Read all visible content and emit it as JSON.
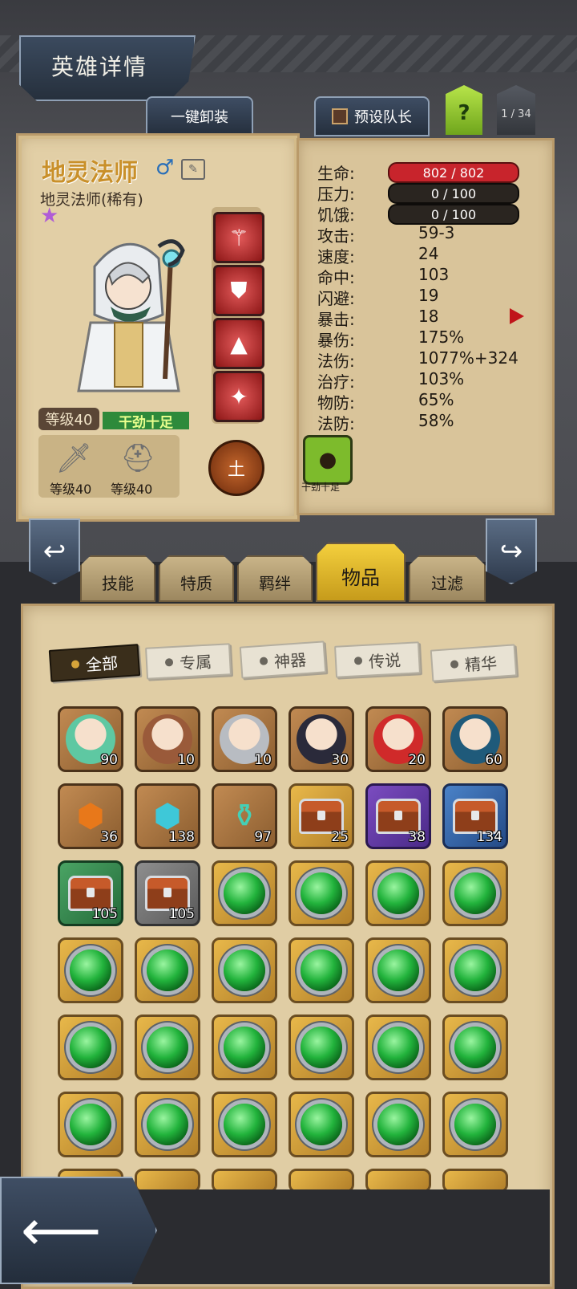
{
  "header": {
    "title": "英雄详情",
    "unequip_label": "一键卸装",
    "preset_captain_label": "预设队长",
    "help_label": "?",
    "pager": "1 / 34"
  },
  "hero": {
    "name": "地灵法师",
    "subtitle": "地灵法师(稀有)",
    "level_label": "等级40",
    "mood": "干劲十足",
    "weapon_level": "等级40",
    "armor_level": "等级40",
    "element": "土",
    "equipment_icons": [
      "staff-icon",
      "chest-armor-icon",
      "wizard-hat-icon",
      "amulet-icon"
    ]
  },
  "stats": {
    "hp": {
      "label": "生命:",
      "value": "802 / 802"
    },
    "stress": {
      "label": "压力:",
      "value": "0 / 100"
    },
    "hunger": {
      "label": "饥饿:",
      "value": "0 / 100"
    },
    "rows": [
      {
        "label": "攻击:",
        "value": "59-3"
      },
      {
        "label": "速度:",
        "value": "24"
      },
      {
        "label": "命中:",
        "value": "103"
      },
      {
        "label": "闪避:",
        "value": "19"
      },
      {
        "label": "暴击:",
        "value": "18"
      },
      {
        "label": "暴伤:",
        "value": "175%"
      },
      {
        "label": "法伤:",
        "value": "1077%+324"
      },
      {
        "label": "治疗:",
        "value": "103%"
      },
      {
        "label": "物防:",
        "value": "65%"
      },
      {
        "label": "法防:",
        "value": "58%"
      }
    ],
    "trait_label": "干劲十足"
  },
  "tabs": [
    {
      "label": "技能"
    },
    {
      "label": "特质"
    },
    {
      "label": "羁绊"
    },
    {
      "label": "物品"
    },
    {
      "label": "过滤"
    }
  ],
  "filters": [
    {
      "label": "全部"
    },
    {
      "label": "专属"
    },
    {
      "label": "神器"
    },
    {
      "label": "传说"
    },
    {
      "label": "精华"
    }
  ],
  "inventory": {
    "row1": [
      {
        "kind": "hero-portrait",
        "count": "90"
      },
      {
        "kind": "hero-portrait",
        "count": "10"
      },
      {
        "kind": "hero-portrait",
        "count": "10"
      },
      {
        "kind": "hero-portrait",
        "count": "30"
      },
      {
        "kind": "hero-portrait",
        "count": "20"
      },
      {
        "kind": "hero-portrait",
        "count": "60"
      }
    ],
    "row2": [
      {
        "kind": "orange-crystal",
        "count": "36"
      },
      {
        "kind": "blue-crystal",
        "count": "138"
      },
      {
        "kind": "potion",
        "count": "97"
      },
      {
        "kind": "chest-gold",
        "count": "25"
      },
      {
        "kind": "chest-purple",
        "count": "38"
      },
      {
        "kind": "chest-blue",
        "count": "134"
      }
    ],
    "row3": [
      {
        "kind": "chest-green",
        "count": "105"
      },
      {
        "kind": "chest-gray",
        "count": "105"
      }
    ]
  },
  "colors": {
    "hp_bar": "#c8242c",
    "bar_dark": "#2a2520",
    "accent_gold": "#f0c93a"
  }
}
